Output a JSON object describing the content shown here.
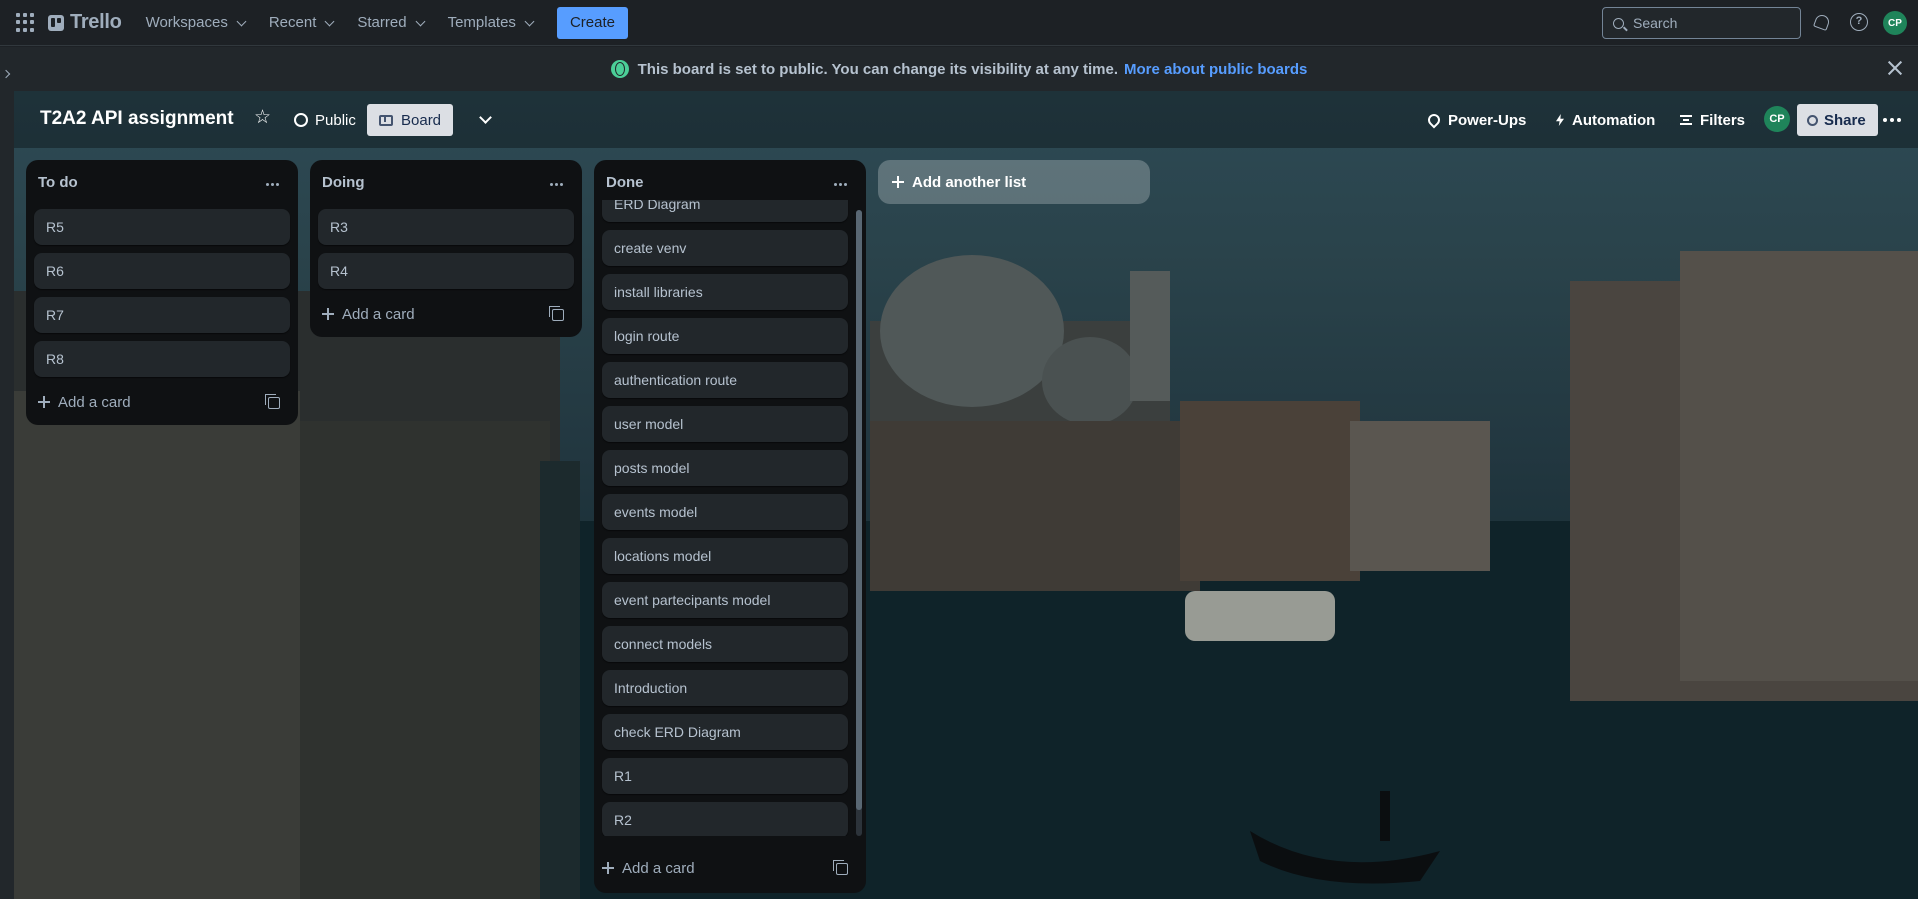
{
  "topnav": {
    "logo": "Trello",
    "menus": [
      "Workspaces",
      "Recent",
      "Starred",
      "Templates"
    ],
    "create_label": "Create",
    "search_placeholder": "Search",
    "avatar_initials": "CP"
  },
  "banner": {
    "text": "This board is set to public. You can change its visibility at any time.",
    "link": "More about public boards"
  },
  "board": {
    "title": "T2A2 API assignment",
    "visibility": "Public",
    "view": "Board",
    "powerups": "Power-Ups",
    "automation": "Automation",
    "filters": "Filters",
    "member_initials": "CP",
    "share": "Share"
  },
  "lists": [
    {
      "title": "To do",
      "cards": [
        "R5",
        "R6",
        "R7",
        "R8"
      ],
      "add_label": "Add a card"
    },
    {
      "title": "Doing",
      "cards": [
        "R3",
        "R4"
      ],
      "add_label": "Add a card"
    },
    {
      "title": "Done",
      "cards": [
        "ERD Diagram",
        "create venv",
        "install libraries",
        "login route",
        "authentication route",
        "user model",
        "posts model",
        "events model",
        "locations model",
        "event partecipants model",
        "connect models",
        "Introduction",
        "check ERD Diagram",
        "R1",
        "R2"
      ],
      "add_label": "Add a card"
    }
  ],
  "add_list_label": "Add another list",
  "colors": {
    "accent": "#579dff",
    "avatar": "#1f845a",
    "banner_icon": "#4bce97"
  }
}
